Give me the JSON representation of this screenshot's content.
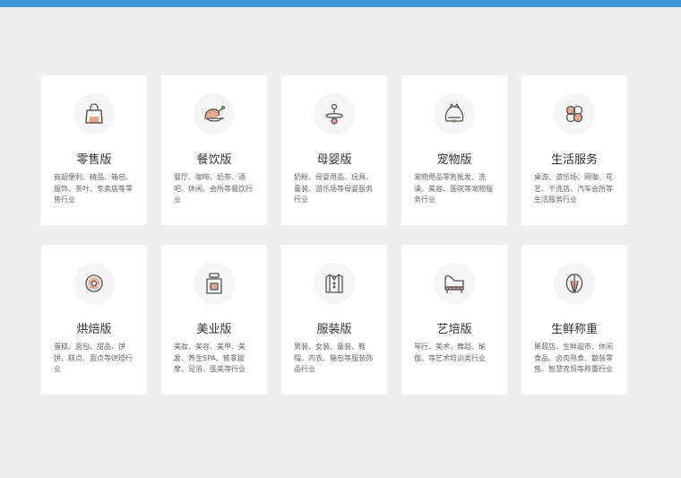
{
  "colors": {
    "topbar": "#3a97d4",
    "page_bg": "#efefef",
    "card_bg": "#ffffff",
    "icon_stroke": "#555555",
    "icon_accent": "#e8a68a"
  },
  "cards": [
    {
      "title": "零售版",
      "desc": "商超便利、精品、箱包、服饰、茶叶、专卖店等零售行业",
      "icon": "shopping-bag-icon"
    },
    {
      "title": "餐饮版",
      "desc": "餐厅、咖啡、奶茶、酒吧、休闲、会所等餐饮行业",
      "icon": "roast-chicken-icon"
    },
    {
      "title": "母婴版",
      "desc": "奶粉、母婴用品、玩具、童装、游乐场等母婴服务行业",
      "icon": "pacifier-icon"
    },
    {
      "title": "宠物版",
      "desc": "宠物用品零售批发、洗澡、美容、医院等宠物服务行业",
      "icon": "pet-icon"
    },
    {
      "title": "生活服务",
      "desc": "桌游、游乐场、网咖、花艺、干洗店、汽车会所等生活服务行业",
      "icon": "clover-icon"
    },
    {
      "title": "烘焙版",
      "desc": "蛋糕、面包、甜品、饼饼、糕点、面点等烘焙行业",
      "icon": "donut-icon"
    },
    {
      "title": "美业版",
      "desc": "美妆、美容、美甲、美发、养生SPA、推拿按摩、足浴、医美等行业",
      "icon": "perfume-icon"
    },
    {
      "title": "服装版",
      "desc": "男装、女装、童装、鞋帽、内衣、箱包等服装饰品行业",
      "icon": "shirt-icon"
    },
    {
      "title": "艺培版",
      "desc": "琴行、美术、舞蹈、瑜伽、等艺术培训类行业",
      "icon": "piano-icon"
    },
    {
      "title": "生鲜称重",
      "desc": "果蔬店、生鲜超市、休闲食品、卤肉熟食、散装零售、智慧农贸等称重行业",
      "icon": "cabbage-icon"
    }
  ]
}
